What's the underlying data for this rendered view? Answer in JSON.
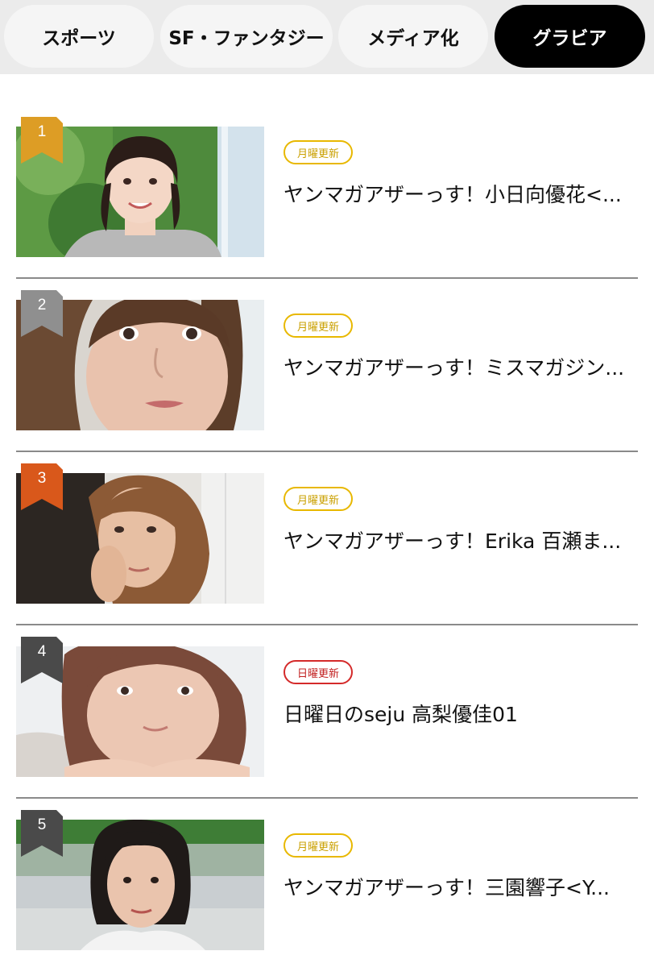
{
  "tabs": [
    {
      "label": "スポーツ",
      "active": false
    },
    {
      "label": "SF・ファンタジー",
      "active": false
    },
    {
      "label": "メディア化",
      "active": false
    },
    {
      "label": "グラビア",
      "active": true
    }
  ],
  "ranking": [
    {
      "rank": "1",
      "badge_color": "#dd9d25",
      "tag": "月曜更新",
      "title": "ヤンマガアザーっす！小日向優花<..."
    },
    {
      "rank": "2",
      "badge_color": "#8f8f8f",
      "tag": "月曜更新",
      "title": "ヤンマガアザーっす！ミスマガジン..."
    },
    {
      "rank": "3",
      "badge_color": "#d9581b",
      "tag": "月曜更新",
      "title": "ヤンマガアザーっす！Erika 百瀬ま..."
    },
    {
      "rank": "4",
      "badge_color": "#4a4a4a",
      "tag": "日曜更新",
      "title": "日曜日のseju 高梨優佳01"
    },
    {
      "rank": "5",
      "badge_color": "#4a4a4a",
      "tag": "月曜更新",
      "title": "ヤンマガアザーっす！三園響子<Y..."
    }
  ]
}
